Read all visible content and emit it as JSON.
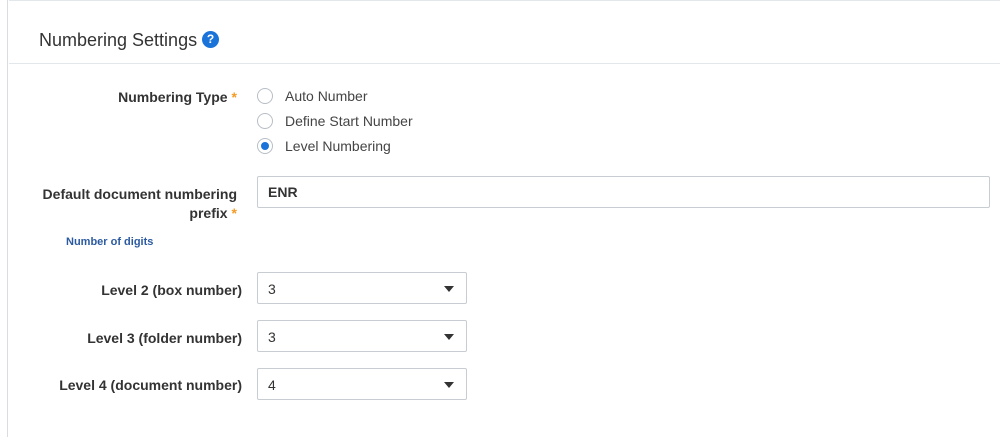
{
  "panel": {
    "title": "Numbering Settings",
    "help_icon": "question-circle-icon",
    "help_glyph": "?"
  },
  "numbering_type": {
    "label": "Numbering Type",
    "required_mark": "*",
    "options": [
      {
        "label": "Auto Number",
        "checked": false
      },
      {
        "label": "Define Start Number",
        "checked": false
      },
      {
        "label": "Level Numbering",
        "checked": true
      }
    ]
  },
  "prefix": {
    "label_line1": "Default document numbering",
    "label_line2": "prefix",
    "required_mark": "*",
    "value": "ENR"
  },
  "digits": {
    "section_label": "Number of digits",
    "levels": [
      {
        "label": "Level 2 (box number)",
        "value": "3"
      },
      {
        "label": "Level 3 (folder number)",
        "value": "3"
      },
      {
        "label": "Level 4 (document number)",
        "value": "4"
      }
    ]
  },
  "colors": {
    "accent": "#1a73d9",
    "required": "#f39c27",
    "section_link": "#2c5aa0"
  }
}
